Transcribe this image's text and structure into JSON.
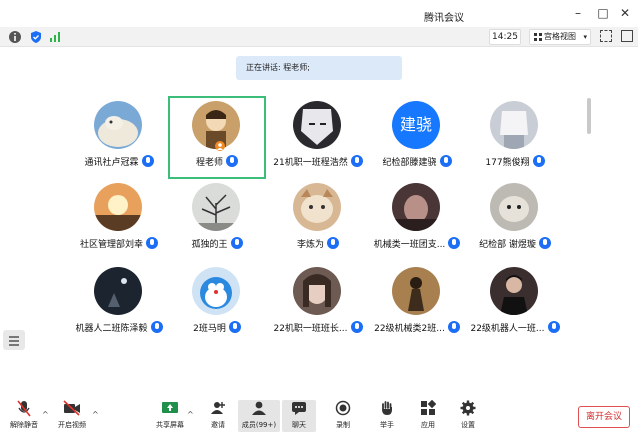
{
  "window": {
    "title": "腾讯会议"
  },
  "topbar": {
    "time": "14:25",
    "view_label": "宫格视图"
  },
  "speaker_banner": "正在讲话: 程老师;",
  "participants": [
    {
      "name": "通讯社卢冠霖",
      "avatar": "photo-goat"
    },
    {
      "name": "程老师",
      "avatar": "photo-cartoon"
    },
    {
      "name": "21机职一班程浩然",
      "avatar": "photo-anime"
    },
    {
      "name": "纪检部滕建骁",
      "avatar_text": "建骁"
    },
    {
      "name": "177熊俊翔",
      "avatar": "photo-white-hair"
    },
    {
      "name": "社区管理部刘幸",
      "avatar": "photo-sunset"
    },
    {
      "name": "孤独的王",
      "avatar": "photo-tree"
    },
    {
      "name": "李炼为",
      "avatar": "photo-cat"
    },
    {
      "name": "机械类一班团支...",
      "avatar": "photo-dark-room"
    },
    {
      "name": "纪检部 谢煜璇",
      "avatar": "photo-cat-gray"
    },
    {
      "name": "机器人二班陈泽毅",
      "avatar": "photo-night"
    },
    {
      "name": "2班马明",
      "avatar": "photo-doraemon"
    },
    {
      "name": "22机职一班班长...",
      "avatar": "photo-girl"
    },
    {
      "name": "22级机械类2班...",
      "avatar": "photo-figure"
    },
    {
      "name": "22级机器人一班...",
      "avatar": "photo-man"
    }
  ],
  "toolbar": {
    "unmute": "解除静音",
    "start_video": "开启视频",
    "share": "共享屏幕",
    "invite": "邀请",
    "members": "成员(99+)",
    "chat": "聊天",
    "record": "录制",
    "raise_hand": "举手",
    "apps": "应用",
    "settings": "设置",
    "leave": "离开会议"
  },
  "colors": {
    "accent": "#1b6ef5",
    "active_border": "#3cbe7a",
    "leave": "#d42f2f",
    "banner": "#dce9f9"
  }
}
